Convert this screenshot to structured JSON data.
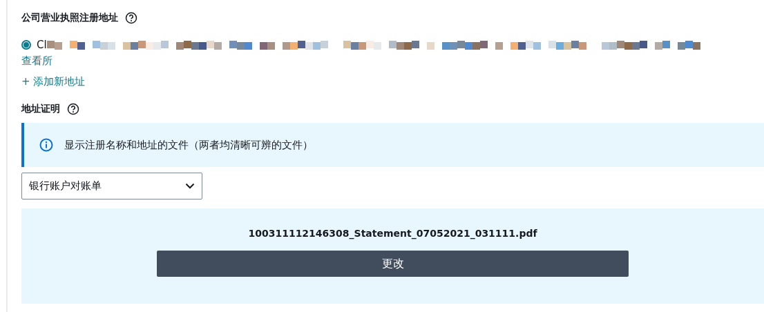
{
  "registered_address": {
    "heading": "公司营业执照注册地址",
    "options": [
      {
        "label": "Cl",
        "selected": true
      }
    ],
    "view_all_link": "查看所",
    "add_link": "+ 添加新地址"
  },
  "address_proof": {
    "heading": "地址证明",
    "info": "显示注册名称和地址的文件（两者均清晰可辨的文件）",
    "document_type": "银行账户对账单",
    "upload": {
      "file_name": "100311112146308_Statement_07052021_031111.pdf",
      "button": "更改"
    }
  }
}
